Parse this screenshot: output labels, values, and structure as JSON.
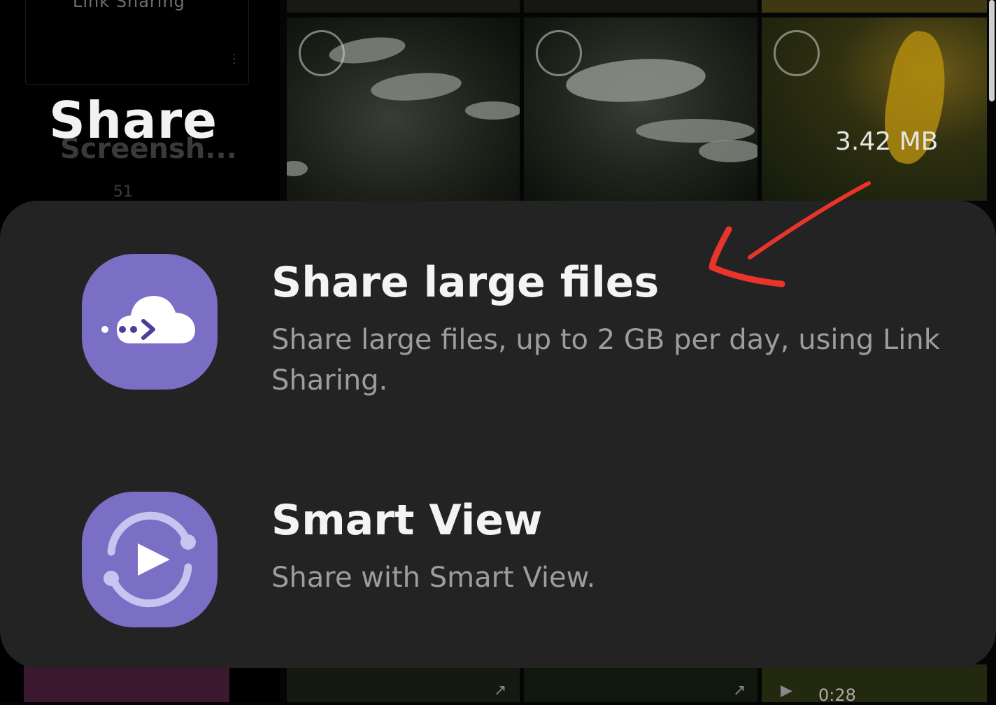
{
  "background": {
    "prev_card_label": "Link Sharing",
    "screenshots_label": "Screensh...",
    "screenshots_count": "51",
    "file_size": "3.42 MB",
    "video_length": "0:28"
  },
  "share_sheet": {
    "title": "Share",
    "options": [
      {
        "icon": "cloud-link-icon",
        "title": "Share large files",
        "description": "Share large files, up to 2 GB per day, using Link Sharing."
      },
      {
        "icon": "smart-view-icon",
        "title": "Smart View",
        "description": "Share with Smart View."
      }
    ]
  },
  "colors": {
    "sheet_background": "#232323",
    "icon_background": "#7a6fc4",
    "annotation_arrow": "#e8342a"
  }
}
